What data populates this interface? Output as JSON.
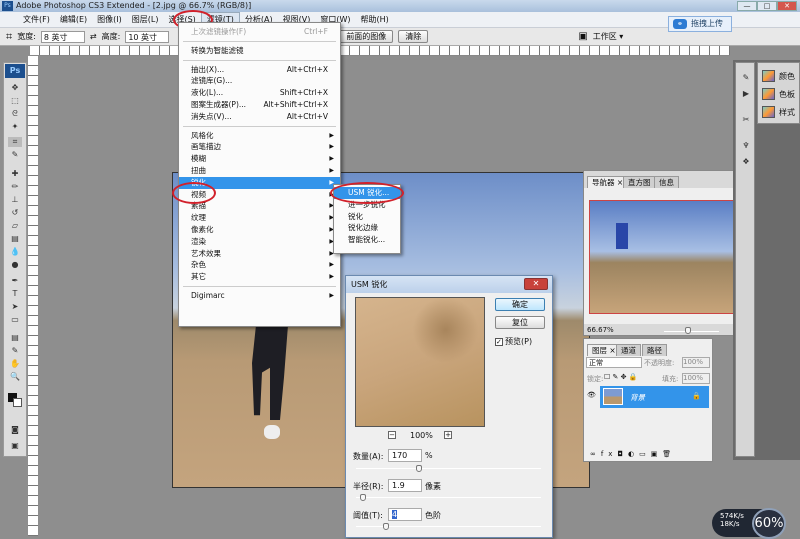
{
  "window": {
    "title": "Adobe Photoshop CS3 Extended - [2.jpg @ 66.7% (RGB/8)]",
    "app_icon": "Ps",
    "min": "—",
    "max": "□",
    "close": "✕"
  },
  "menubar": [
    "文件(F)",
    "编辑(E)",
    "图像(I)",
    "图层(L)",
    "选择(S)",
    "滤镜(T)",
    "分析(A)",
    "视图(V)",
    "窗口(W)",
    "帮助(H)"
  ],
  "options": {
    "crop_icon": "crop-icon",
    "width_label": "宽度:",
    "width_value": "8 英寸",
    "swap": "⇄",
    "height_label": "高度:",
    "height_value": "10 英寸",
    "front_image": "前面的图像",
    "clear": "清除",
    "workspace": "工作区 ▾"
  },
  "upload": {
    "label": "拖拽上传",
    "icon": "cloud-icon"
  },
  "filter_menu": {
    "last": {
      "label": "上次滤镜操作(F)",
      "shortcut": "Ctrl+F"
    },
    "smart": "转换为智能滤镜",
    "group1": [
      {
        "label": "抽出(X)...",
        "shortcut": "Alt+Ctrl+X"
      },
      {
        "label": "滤镜库(G)...",
        "shortcut": ""
      },
      {
        "label": "液化(L)...",
        "shortcut": "Shift+Ctrl+X"
      },
      {
        "label": "图案生成器(P)...",
        "shortcut": "Alt+Shift+Ctrl+X"
      },
      {
        "label": "消失点(V)...",
        "shortcut": "Alt+Ctrl+V"
      }
    ],
    "group2": [
      "风格化",
      "画笔描边",
      "模糊",
      "扭曲",
      "锐化",
      "视频",
      "素描",
      "纹理",
      "像素化",
      "渲染",
      "艺术效果",
      "杂色",
      "其它"
    ],
    "highlighted": "锐化",
    "digimarc": "Digimarc"
  },
  "sharpen_submenu": [
    "USM 锐化...",
    "进一步锐化",
    "锐化",
    "锐化边缘",
    "智能锐化..."
  ],
  "usm_dialog": {
    "title": "USM 锐化",
    "ok": "确定",
    "reset": "复位",
    "preview_label": "预览(P)",
    "preview_checked": true,
    "zoom": "100%",
    "zoom_out": "−",
    "zoom_in": "+",
    "amount": {
      "label": "数量(A):",
      "value": "170",
      "unit": "%",
      "slider": 0.34
    },
    "radius": {
      "label": "半径(R):",
      "value": "1.9",
      "unit": "像素",
      "slider": 0.04
    },
    "threshold": {
      "label": "阈值(T):",
      "value": "4",
      "unit": "色阶",
      "slider": 0.16
    }
  },
  "navigator": {
    "tabs": [
      "导航器 ×",
      "直方图",
      "信息"
    ],
    "zoom": "66.67%"
  },
  "layers": {
    "tabs": [
      "图层 ×",
      "通道",
      "路径"
    ],
    "blend": "正常",
    "opacity_label": "不透明度:",
    "opacity": "100%",
    "lock_label": "锁定:",
    "fill_label": "填充:",
    "fill": "100%",
    "layer_name": "背景"
  },
  "dock": {
    "items": [
      "颜色",
      "色板",
      "样式"
    ]
  },
  "netspeed": {
    "up": "574K/s",
    "down": "18K/s",
    "gauge": "60%"
  }
}
